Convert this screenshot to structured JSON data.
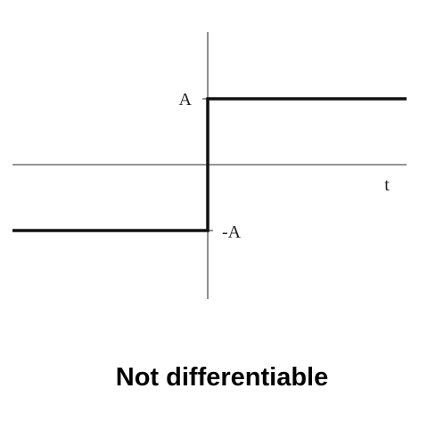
{
  "chart_data": {
    "type": "line",
    "title": "",
    "xlabel": "t",
    "ylabel": "",
    "ytick_labels": [
      "A",
      "-A"
    ],
    "series": [
      {
        "x": [
          -1,
          0,
          0,
          1
        ],
        "y": [
          -1,
          -1,
          1,
          1
        ]
      }
    ],
    "ylim": [
      -2,
      2
    ],
    "xlim": [
      -1,
      1
    ],
    "grid": false,
    "colors": {
      "axis": "#555555",
      "signal": "#111111"
    }
  },
  "caption": "Not differentiable"
}
